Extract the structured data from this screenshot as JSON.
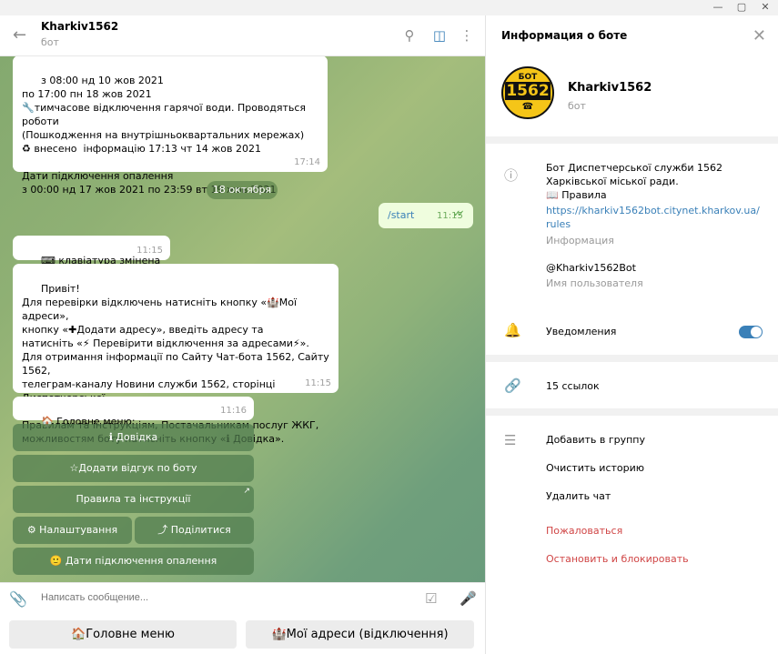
{
  "window": {
    "minimize": "—",
    "maximize": "▢",
    "close": "✕"
  },
  "chat": {
    "title": "Kharkiv1562",
    "subtitle": "бот",
    "date_pill": "18 октября",
    "messages": [
      {
        "text": "з 08:00 нд 10 жов 2021\nпо 17:00 пн 18 жов 2021\n🔧тимчасове відключення гарячої води. Проводяться роботи\n(Пошкодження на внутрішньоквартальних мережах)\n♻ внесено  інформацію 17:13 чт 14 жов 2021\n\nДати підключення опалення\nз 00:00 нд 17 жов 2021 по 23:59 вт 19 жов 2021",
        "time": "17:14"
      },
      {
        "text": "⌨ клавіатура змінена",
        "time": "11:15"
      },
      {
        "text": "Привіт!\nДля перевірки відключень натисніть кнопку «🏰Мої адреси»,\nкнопку «✚Додати адресу», введіть адресу та\nнатисніть «⚡ Перевірити відключення за адресами⚡».\nДля отримання інформації по Сайту Чат-бота 1562, Сайту 1562,\nтелеграм-каналу Новини служби 1562, сторінці Диспетчерської\nслужби 1562 у facebook,\nПравилам та інструкціям, Постачальникам послуг ЖКГ,\nможливостям боту натисніть кнопку «ℹ Довідка».",
        "time": "11:15"
      },
      {
        "text": "🏠 Головне меню:",
        "time": "11:16"
      }
    ],
    "outgoing": {
      "text": "/start",
      "time": "11:15",
      "ticks": "✓✓"
    },
    "inline_buttons": [
      {
        "label": "ℹ Довідка"
      },
      {
        "label": "☆Додати відгук по боту"
      },
      {
        "label": "Правила та інструкції",
        "arrow": "↗"
      },
      {
        "label": "⚙ Налаштування"
      },
      {
        "label": "⤴ Поділитися"
      },
      {
        "label": "🙂 Дати підключення опалення"
      }
    ],
    "composer_placeholder": "Написать сообщение...",
    "reply_keyboard": [
      {
        "label": "🏠Головне меню"
      },
      {
        "label": "🏰Мої адреси (відключення)"
      }
    ]
  },
  "info": {
    "title": "Информация о боте",
    "bot_name": "Kharkiv1562",
    "bot_sub": "бот",
    "avatar": {
      "top": "БОТ",
      "number": "1562",
      "bottom": "☎"
    },
    "description": "Бот Диспетчерської служби 1562 Харківської міської ради.\n📖 Правила",
    "link": "https://kharkiv1562bot.citynet.kharkov.ua/rules",
    "info_label": "Информация",
    "username": "@Kharkiv1562Bot",
    "username_label": "Имя пользователя",
    "notifications": "Уведомления",
    "notifications_on": true,
    "links": "15 ссылок",
    "actions": [
      "Добавить в группу",
      "Очистить историю",
      "Удалить чат"
    ],
    "danger_actions": [
      "Пожаловаться",
      "Остановить и блокировать"
    ],
    "accent": "#3a80b8",
    "danger_color": "#d04545"
  }
}
